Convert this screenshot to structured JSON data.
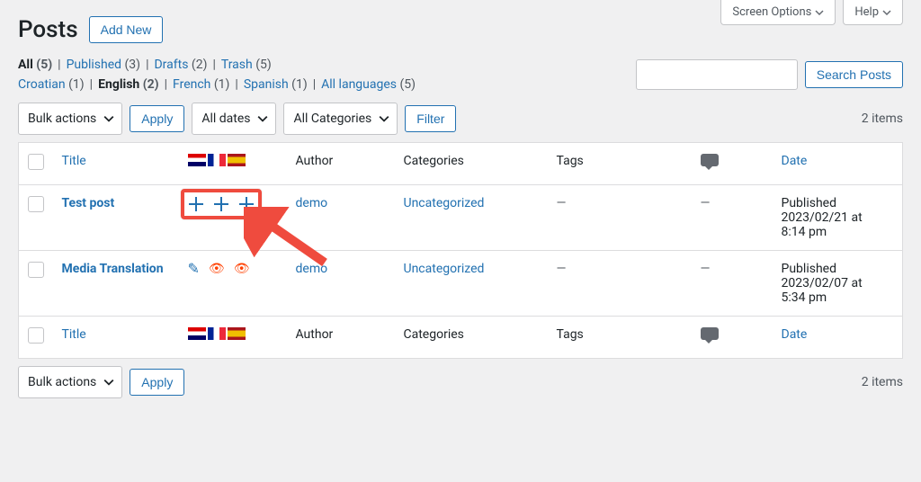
{
  "screen": {
    "screen_options_label": "Screen Options",
    "help_label": "Help"
  },
  "header": {
    "title": "Posts",
    "add_new_label": "Add New"
  },
  "filters_status": [
    {
      "label": "All",
      "count": "(5)",
      "current": true
    },
    {
      "label": "Published",
      "count": "(3)",
      "current": false
    },
    {
      "label": "Drafts",
      "count": "(2)",
      "current": false
    },
    {
      "label": "Trash",
      "count": "(5)",
      "current": false
    }
  ],
  "filters_lang": [
    {
      "label": "Croatian",
      "count": "(1)",
      "current": false
    },
    {
      "label": "English",
      "count": "(2)",
      "current": true
    },
    {
      "label": "French",
      "count": "(1)",
      "current": false
    },
    {
      "label": "Spanish",
      "count": "(1)",
      "current": false
    },
    {
      "label": "All languages",
      "count": "(5)",
      "current": false
    }
  ],
  "search": {
    "button_label": "Search Posts"
  },
  "tablenav": {
    "bulk_label": "Bulk actions",
    "apply_label": "Apply",
    "dates_label": "All dates",
    "categories_label": "All Categories",
    "filter_label": "Filter",
    "items_count": "2 items"
  },
  "columns": {
    "title": "Title",
    "author": "Author",
    "categories": "Categories",
    "tags": "Tags",
    "date": "Date"
  },
  "flags": [
    "hr",
    "fr",
    "es"
  ],
  "rows": [
    {
      "title": "Test post",
      "lang_mode": "plus",
      "author": "demo",
      "categories": "Uncategorized",
      "tags": "—",
      "comments": "—",
      "date_status": "Published",
      "date_line1": "2023/02/21 at",
      "date_line2": "8:14 pm"
    },
    {
      "title": "Media Translation",
      "lang_mode": "edit",
      "author": "demo",
      "categories": "Uncategorized",
      "tags": "—",
      "comments": "—",
      "date_status": "Published",
      "date_line1": "2023/02/07 at",
      "date_line2": "5:34 pm"
    }
  ],
  "annotation": {
    "target": "row1-plus-icons"
  }
}
